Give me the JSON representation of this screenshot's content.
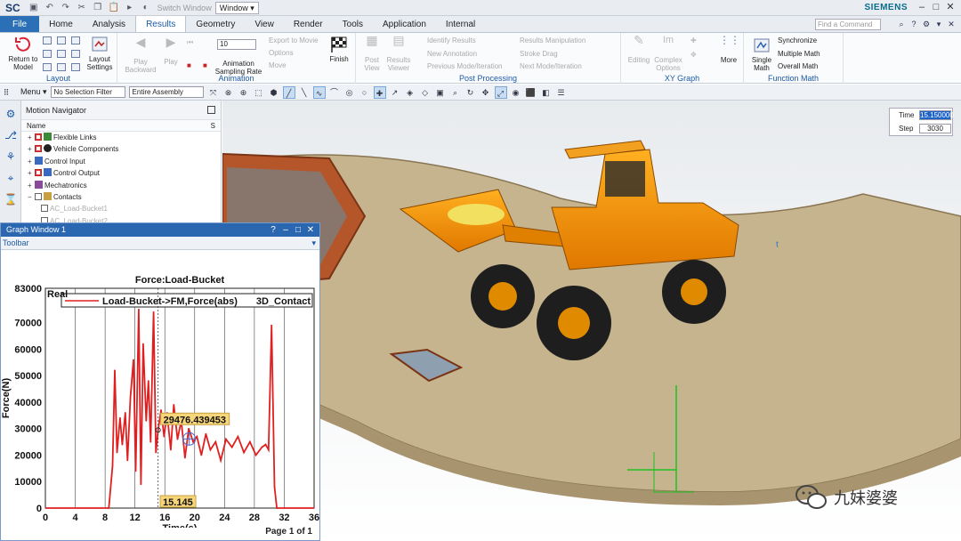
{
  "app": {
    "logo": "SC",
    "brand": "SIEMENS",
    "switch_window": "Switch Window",
    "window_menu": "Window ▾"
  },
  "tabs": [
    "File",
    "Home",
    "Analysis",
    "Results",
    "Geometry",
    "View",
    "Render",
    "Tools",
    "Application",
    "Internal"
  ],
  "command_search_placeholder": "Find a Command",
  "ribbon": {
    "layout": {
      "label": "Layout",
      "return": "Return to Model",
      "settings": "Layout Settings"
    },
    "animation": {
      "label": "Animation",
      "play_backward": "Play Backward",
      "play": "Play",
      "rate_value": "10",
      "rate_label": "Animation Sampling Rate",
      "export": "Export to Movie",
      "options": "Options",
      "move": "Move",
      "finish": "Finish"
    },
    "post": {
      "label": "Post Processing",
      "post_views": "Post View",
      "results_viewer": "Results Viewer",
      "identify": "Identify Results",
      "new_annotation": "New Annotation",
      "previous_mode": "Previous Mode/Iteration",
      "manipulation": "Results Manipulation",
      "stroke_drag": "Stroke Drag",
      "next_mode": "Next Mode/Iteration"
    },
    "xy": {
      "label": "XY Graph",
      "editing": "Editing",
      "complex": "Complex Options",
      "more": "More"
    },
    "fmath": {
      "label": "Function Math",
      "single": "Single Math",
      "sync": "Synchronize",
      "multiple": "Multiple Math",
      "overall": "Overall Math"
    }
  },
  "selection": {
    "menu": "Menu ▾",
    "filter": "No Selection Filter",
    "scope": "Entire Assembly"
  },
  "navigator": {
    "title": "Motion Navigator",
    "column": "Name",
    "col_s": "S",
    "items": [
      {
        "label": "Flexible Links",
        "checked": true
      },
      {
        "label": "Vehicle Components",
        "checked": true
      },
      {
        "label": "Control Input",
        "checked": false
      },
      {
        "label": "Control Output",
        "checked": true
      },
      {
        "label": "Mechatronics",
        "checked": false
      },
      {
        "label": "Contacts",
        "checked": false
      }
    ],
    "subitems": [
      "AC_Load-Bucket1",
      "AC_Load-Bucket2"
    ]
  },
  "graph_window": {
    "title": "Graph Window 1",
    "toolbar": "Toolbar",
    "footer": "Page 1 of 1"
  },
  "chart_data": {
    "type": "line",
    "title": "Force:Load-Bucket",
    "xlabel": "Time(s)",
    "ylabel": "Force(N)",
    "xlim": [
      0,
      36
    ],
    "ylim": [
      0,
      83000
    ],
    "xticks": [
      0,
      4,
      8,
      12,
      16,
      20,
      24,
      28,
      32,
      36
    ],
    "yticks": [
      0,
      10000,
      20000,
      30000,
      40000,
      50000,
      60000,
      70000,
      83000
    ],
    "corner_label": "Real",
    "legend": [
      {
        "name": "Load-Bucket->FM,Force(abs)",
        "extra": "3D_Contact",
        "color": "#e02020"
      }
    ],
    "series": [
      {
        "name": "Load-Bucket->FM,Force(abs)",
        "color": "#e02020",
        "x": [
          0,
          8.5,
          9.0,
          9.3,
          9.6,
          10.0,
          10.3,
          10.7,
          11.0,
          11.4,
          11.8,
          12.1,
          12.5,
          12.8,
          13.1,
          13.5,
          13.8,
          14.1,
          14.5,
          14.8,
          15.1,
          15.5,
          15.9,
          16.3,
          16.8,
          17.2,
          17.7,
          18.2,
          18.7,
          19.2,
          19.8,
          20.3,
          20.9,
          21.5,
          22.1,
          22.8,
          23.5,
          24.2,
          25.0,
          25.8,
          26.6,
          27.4,
          28.2,
          29.0,
          29.5,
          29.9,
          30.3,
          30.7,
          31.0,
          32,
          36
        ],
        "y": [
          0,
          0,
          16000,
          52000,
          21000,
          34000,
          24000,
          36000,
          18000,
          42000,
          56000,
          14000,
          75000,
          9000,
          62000,
          33000,
          48000,
          25000,
          74000,
          21000,
          29476,
          37000,
          27000,
          36000,
          22000,
          39000,
          26000,
          33000,
          19000,
          30000,
          25000,
          27000,
          20000,
          28000,
          22000,
          25000,
          18000,
          26000,
          23000,
          27000,
          21000,
          25000,
          20000,
          23000,
          24000,
          22000,
          69000,
          8000,
          0,
          0,
          0
        ]
      }
    ],
    "annotations": [
      {
        "label": "29476.439453",
        "x": 15.1,
        "y": 29476
      },
      {
        "label": "15.145",
        "x": 15.145,
        "y": 0
      }
    ]
  },
  "playback": {
    "time_label": "Time",
    "time_value": "15.150000",
    "step_label": "Step",
    "step_value": "3030"
  },
  "watermark": {
    "text": "九妹婆婆"
  }
}
